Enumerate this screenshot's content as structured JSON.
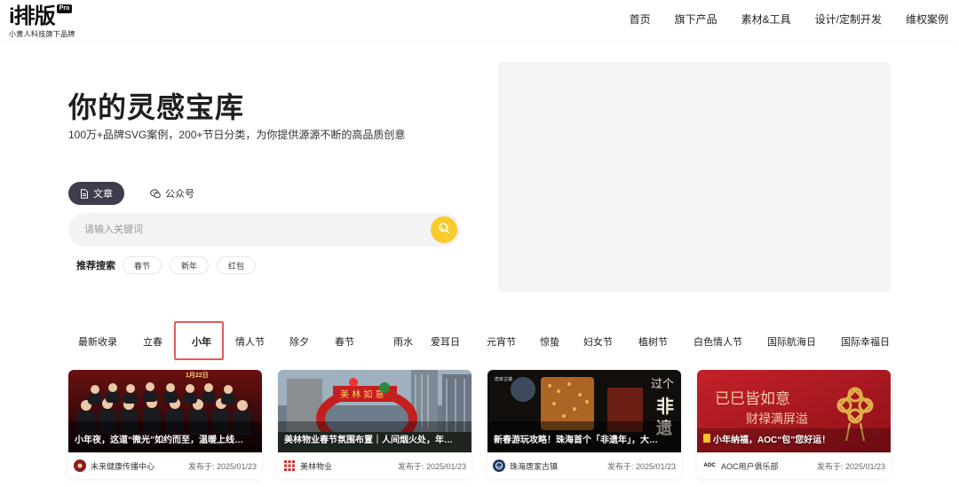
{
  "header": {
    "logo_text": "i排版",
    "logo_badge": "Pro",
    "logo_sub": "小黄人科技旗下品牌",
    "nav": [
      "首页",
      "旗下产品",
      "素材&工具",
      "设计/定制开发",
      "维权案例"
    ]
  },
  "hero": {
    "title": "你的灵感宝库",
    "subtitle": "100万+品牌SVG案例，200+节日分类，为你提供源源不断的高品质创意",
    "tabs": [
      {
        "label": "文章",
        "icon": "document-icon",
        "active": true
      },
      {
        "label": "公众号",
        "icon": "wechat-icon",
        "active": false
      }
    ],
    "search": {
      "placeholder": "请输入关键词",
      "value": ""
    },
    "recommend_label": "推荐搜索",
    "recommend_tags": [
      "春节",
      "新年",
      "红包"
    ]
  },
  "categories": {
    "items": [
      "最新收录",
      "立春",
      "小年",
      "情人节",
      "除夕",
      "春节",
      "雨水",
      "爱耳日",
      "元宵节",
      "惊蛰",
      "妇女节",
      "植树节",
      "白色情人节",
      "国际航海日",
      "国际幸福日"
    ],
    "active": "小年"
  },
  "cards": [
    {
      "title": "小年夜，这道“微光”如约而至，温暖上线…",
      "image_overlay": "1月22日",
      "author": "未来健康传播中心",
      "date": "发布于: 2025/01/23",
      "accent": "#8a1e1e"
    },
    {
      "title": "美林物业春节氛围布置｜人间烟火处，年…",
      "image_overlay": "",
      "author": "美林物业",
      "date": "发布于: 2025/01/23",
      "accent": "#d42b2b"
    },
    {
      "title": "新春游玩攻略！珠海首个「非遗年」，大…",
      "image_overlay": "过个 非遗 年",
      "author": "珠海唐家古镇",
      "date": "发布于: 2025/01/23",
      "accent": "#1e3a6e"
    },
    {
      "title": "小年纳福，AOC“包”您好运！",
      "image_overlay": "已巳皆如意",
      "image_overlay2": "财禄满屏溢",
      "author": "AOC用户俱乐部",
      "author_logo": "AOC",
      "date": "发布于: 2025/01/23",
      "accent": "#b81c22"
    }
  ],
  "colors": {
    "accent_yellow": "#f7cc2c",
    "active_tab": "#3d3d4d",
    "highlight_border": "#e85b5b"
  }
}
